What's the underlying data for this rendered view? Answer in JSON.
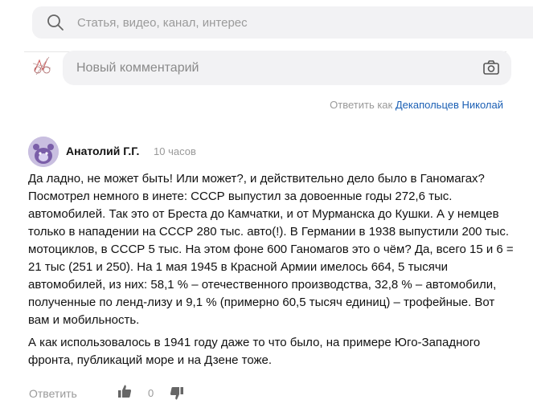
{
  "search": {
    "placeholder": "Статья, видео, канал, интерес",
    "icon": "search-icon"
  },
  "new_comment": {
    "placeholder": "Новый комментарий",
    "icon": "camera-icon"
  },
  "reply_as": {
    "label": "Ответить как",
    "user": "Декапольцев Николай"
  },
  "comment": {
    "author": "Анатолий Г.Г.",
    "time": "10 часов",
    "paragraphs": [
      "Да ладно, не может быть! Или может?, и действительно дело было в Ганомагах? Посмотрел немного в инете: СССР выпустил за довоенные годы 272,6 тыс. автомобилей. Так это от Бреста до Камчатки, и от Мурманска до Кушки. А у немцев только в нападении на СССР 280 тыс. авто(!). В Германии в 1938 выпустили 200 тыс. мотоциклов, в СССР 5 тыс. На этом фоне 600 Ганомагов это о чём? Да, всего 15 и 6 = 21 тыс (251 и 250). На 1 мая 1945 в Красной Армии имелось 664, 5 тысячи автомобилей, из них: 58,1 % – отечественного производства, 32,8 % – автомобили, полученные по ленд-лизу и 9,1 % (примерно 60,5 тысяч единиц) – трофейные. Вот вам и мобильность.",
      "А как использовалось в 1941 году даже то что было, на примере Юго-Западного фронта, публикаций море и на Дзене тоже."
    ],
    "reply_label": "Ответить",
    "likes": "0"
  },
  "colors": {
    "search_bg": "#f2f2f4",
    "link": "#1a5fb4",
    "muted": "#999999",
    "avatar_bg": "#c9bfe0"
  }
}
